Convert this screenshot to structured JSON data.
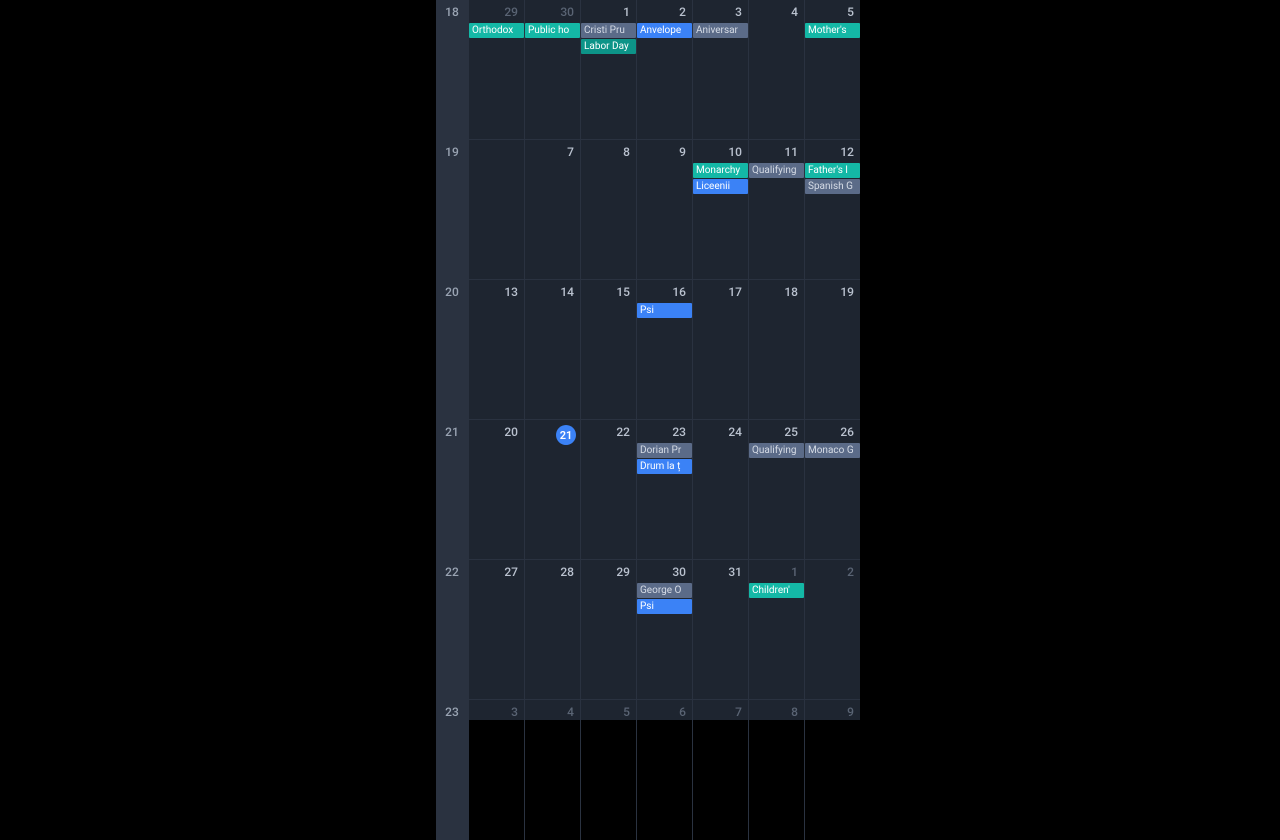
{
  "colors": {
    "teal": "#14b8a6",
    "blue": "#3b82f6",
    "slate": "#5b6b88",
    "purple": "#7c6ba8"
  },
  "weeks": [
    {
      "weeknum": "18",
      "days": [
        {
          "num": "29",
          "otherMonth": true,
          "events": [
            {
              "label": "Orthodox",
              "color": "teal"
            }
          ]
        },
        {
          "num": "30",
          "otherMonth": true,
          "events": [
            {
              "label": "Public ho",
              "color": "teal"
            }
          ]
        },
        {
          "num": "1",
          "events": [
            {
              "label": "Cristi Pru",
              "color": "slate"
            },
            {
              "label": "Labor Day",
              "color": "teal-dark"
            }
          ]
        },
        {
          "num": "2",
          "events": [
            {
              "label": "Anvelope",
              "color": "blue"
            }
          ]
        },
        {
          "num": "3",
          "events": [
            {
              "label": "Aniversar",
              "color": "slate"
            }
          ]
        },
        {
          "num": "4",
          "events": []
        },
        {
          "num": "5",
          "events": [
            {
              "label": "Mother's",
              "color": "teal"
            }
          ]
        }
      ]
    },
    {
      "weeknum": "19",
      "days": [
        {
          "num": "",
          "events": []
        },
        {
          "num": "7",
          "events": []
        },
        {
          "num": "8",
          "events": []
        },
        {
          "num": "9",
          "events": []
        },
        {
          "num": "10",
          "events": [
            {
              "label": "Monarchy",
              "color": "teal"
            },
            {
              "label": "Liceenii",
              "color": "blue"
            }
          ]
        },
        {
          "num": "11",
          "events": [
            {
              "label": "Qualifying",
              "color": "slate"
            }
          ]
        },
        {
          "num": "12",
          "events": [
            {
              "label": "Father's l",
              "color": "teal"
            },
            {
              "label": "Spanish G",
              "color": "slate"
            }
          ]
        }
      ]
    },
    {
      "weeknum": "20",
      "days": [
        {
          "num": "13",
          "events": []
        },
        {
          "num": "14",
          "events": []
        },
        {
          "num": "15",
          "events": []
        },
        {
          "num": "16",
          "events": [
            {
              "label": "Psi",
              "color": "blue"
            }
          ]
        },
        {
          "num": "17",
          "events": []
        },
        {
          "num": "18",
          "events": []
        },
        {
          "num": "19",
          "events": []
        }
      ]
    },
    {
      "weeknum": "21",
      "days": [
        {
          "num": "20",
          "events": []
        },
        {
          "num": "21",
          "today": true,
          "events": []
        },
        {
          "num": "22",
          "events": []
        },
        {
          "num": "23",
          "events": [
            {
              "label": "Dorian Pr",
              "color": "slate"
            },
            {
              "label": "Drum la ț",
              "color": "blue"
            }
          ]
        },
        {
          "num": "24",
          "events": []
        },
        {
          "num": "25",
          "events": [
            {
              "label": "Qualifying",
              "color": "slate"
            }
          ]
        },
        {
          "num": "26",
          "events": [
            {
              "label": "Monaco G",
              "color": "slate"
            }
          ]
        }
      ]
    },
    {
      "weeknum": "22",
      "days": [
        {
          "num": "27",
          "events": []
        },
        {
          "num": "28",
          "events": []
        },
        {
          "num": "29",
          "events": []
        },
        {
          "num": "30",
          "events": [
            {
              "label": "George O",
              "color": "slate"
            },
            {
              "label": "Psi",
              "color": "blue"
            }
          ]
        },
        {
          "num": "31",
          "events": []
        },
        {
          "num": "1",
          "otherMonth": true,
          "events": [
            {
              "label": "Children'",
              "color": "teal"
            }
          ]
        },
        {
          "num": "2",
          "otherMonth": true,
          "events": []
        }
      ]
    },
    {
      "weeknum": "23",
      "days": [
        {
          "num": "3",
          "otherMonth": true,
          "events": []
        },
        {
          "num": "4",
          "otherMonth": true,
          "events": []
        },
        {
          "num": "5",
          "otherMonth": true,
          "events": []
        },
        {
          "num": "6",
          "otherMonth": true,
          "events": []
        },
        {
          "num": "7",
          "otherMonth": true,
          "events": []
        },
        {
          "num": "8",
          "otherMonth": true,
          "events": []
        },
        {
          "num": "9",
          "otherMonth": true,
          "events": []
        }
      ]
    }
  ]
}
